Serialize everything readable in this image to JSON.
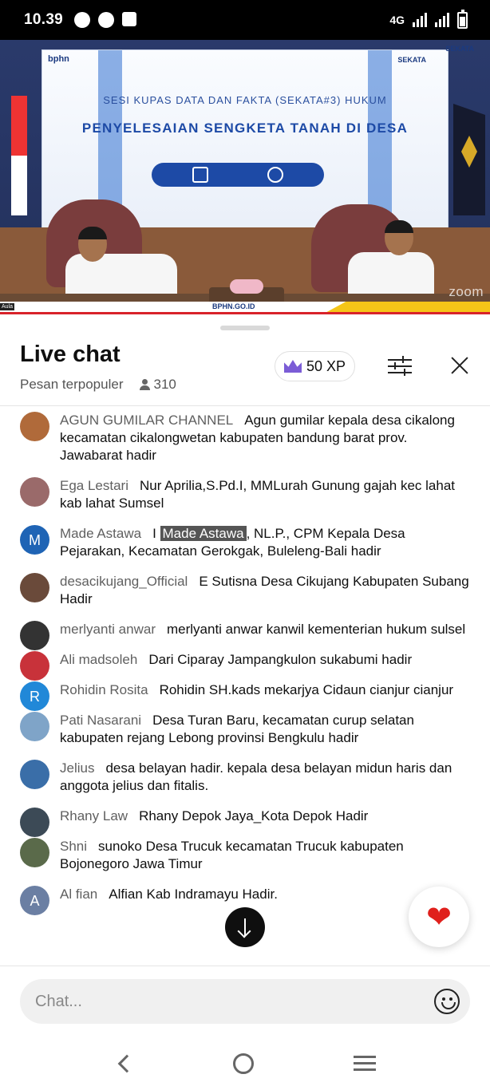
{
  "status_bar": {
    "time": "10.39",
    "network": "4G",
    "icons": [
      "whatsapp-icon",
      "compass-icon",
      "files-icon",
      "signal-icon",
      "signal-icon",
      "battery-icon"
    ]
  },
  "video": {
    "subtitle": "SESI KUPAS DATA DAN FAKTA (SEKATA#3) HUKUM",
    "headline": "PENYELESAIAN SENGKETA TANAH DI DESA",
    "logo_left": "bphn",
    "logo_right": "SEKATA",
    "url": "BPHN.GO.ID",
    "location_tag": "Aula",
    "watermark": "zoom"
  },
  "chat": {
    "title": "Live chat",
    "mode": "Pesan terpopuler",
    "viewer_count": "310",
    "xp_label": "50 XP",
    "input_placeholder": "Chat...",
    "messages": [
      {
        "author": "AGUN GUMILAR CHANNEL",
        "text": "Agun gumilar kepala desa cikalong kecamatan cikalongwetan kabupaten bandung barat prov. Jawabarat hadir",
        "avatar_color": "#b06a3a",
        "avatar_letter": ""
      },
      {
        "author": "Ega Lestari",
        "text": "Nur Aprilia,S.Pd.I, MMLurah Gunung gajah kec lahat kab lahat Sumsel",
        "avatar_color": "#9a6a6a",
        "avatar_letter": ""
      },
      {
        "author": "Made Astawa",
        "text_pre": "I ",
        "text_highlight": "Made Astawa",
        "text_post": ", NL.P., CPM Kepala Desa Pejarakan, Kecamatan Gerokgak, Buleleng-Bali hadir",
        "avatar_color": "#1f64b5",
        "avatar_letter": "M"
      },
      {
        "author": "desacikujang_Official",
        "text": "E Sutisna Desa Cikujang Kabupaten Subang Hadir",
        "avatar_color": "#6a4a3a",
        "avatar_letter": ""
      },
      {
        "author": "merlyanti anwar",
        "text": "merlyanti anwar kanwil kementerian hukum sulsel",
        "avatar_color": "#333333",
        "avatar_letter": ""
      },
      {
        "author": "Ali madsoleh",
        "text": "Dari Ciparay Jampangkulon sukabumi hadir",
        "avatar_color": "#c8323a",
        "avatar_letter": ""
      },
      {
        "author": "Rohidin Rosita",
        "text": "Rohidin SH.kads mekarjya Cidaun cianjur cianjur",
        "avatar_color": "#2188d8",
        "avatar_letter": "R"
      },
      {
        "author": "Pati Nasarani",
        "text": "Desa Turan Baru, kecamatan curup selatan kabupaten rejang Lebong provinsi Bengkulu hadir",
        "avatar_color": "#7fa4c8",
        "avatar_letter": ""
      },
      {
        "author": "Jelius",
        "text": "desa belayan hadir. kepala desa belayan midun haris dan anggota jelius dan fitalis.",
        "avatar_color": "#3a6ea8",
        "avatar_letter": ""
      },
      {
        "author": "Rhany Law",
        "text": "Rhany Depok Jaya_Kota Depok Hadir",
        "avatar_color": "#3c4a56",
        "avatar_letter": ""
      },
      {
        "author": "Shni",
        "text": "sunoko Desa Trucuk kecamatan Trucuk kabupaten Bojonegoro Jawa Timur",
        "avatar_color": "#5a6a4a",
        "avatar_letter": ""
      },
      {
        "author": "Al fian",
        "text": "Alfian Kab Indramayu Hadir.",
        "avatar_color": "#6b7fa3",
        "avatar_letter": "A"
      }
    ]
  },
  "colors": {
    "accent_xp": "#7b5cd6",
    "heart": "#e0201c",
    "highlight": "#555555"
  }
}
